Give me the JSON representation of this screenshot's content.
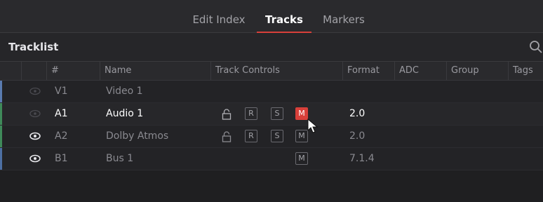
{
  "tabs": [
    {
      "label": "Edit Index",
      "active": false
    },
    {
      "label": "Tracks",
      "active": true
    },
    {
      "label": "Markers",
      "active": false
    }
  ],
  "tracklist": {
    "title": "Tracklist"
  },
  "columns": {
    "num": "#",
    "name": "Name",
    "controls": "Track Controls",
    "format": "Format",
    "adc": "ADC",
    "group": "Group",
    "tags": "Tags"
  },
  "rows": [
    {
      "id": "V1",
      "name": "Video 1",
      "format": "",
      "stripe": "#5a7bb0",
      "eye": "dim",
      "selected": false
    },
    {
      "id": "A1",
      "name": "Audio 1",
      "format": "2.0",
      "stripe": "#3f8a5a",
      "eye": "dim",
      "selected": true
    },
    {
      "id": "A2",
      "name": "Dolby Atmos",
      "format": "2.0",
      "stripe": "#3f8a5a",
      "eye": "on",
      "selected": false
    },
    {
      "id": "B1",
      "name": "Bus 1",
      "format": "7.1.4",
      "stripe": "#4d6fa3",
      "eye": "on",
      "selected": false
    }
  ],
  "controls": {
    "record": "R",
    "solo": "S",
    "mute": "M"
  },
  "colors": {
    "accent": "#d8403a",
    "background": "#1f1f21"
  }
}
